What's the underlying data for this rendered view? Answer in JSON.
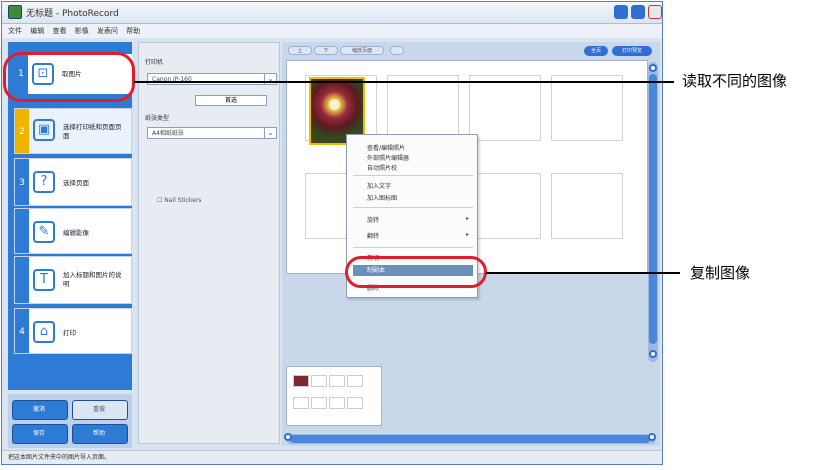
{
  "window": {
    "title": "无标题 - PhotoRecord",
    "menu": [
      "文件",
      "编辑",
      "查看",
      "影像",
      "发表问",
      "帮助"
    ],
    "status": "把这本图片文件夹中的图片导入页面。"
  },
  "steps": [
    {
      "num": "1",
      "label": "取图片",
      "icon_name": "image-import-icon"
    },
    {
      "num": "2",
      "label": "选择打印纸和页面页面",
      "icon_name": "printer-icon"
    },
    {
      "num": "3",
      "label": "选择页面",
      "icon_name": "layout-icon"
    },
    {
      "num": "",
      "label": "编辑影像",
      "icon_name": "edit-image-icon"
    },
    {
      "num": "",
      "label": "加入标题和图片的说明",
      "icon_name": "caption-icon"
    },
    {
      "num": "4",
      "label": "打印",
      "icon_name": "print-icon"
    }
  ],
  "bottom_buttons": [
    "撤消",
    "重做",
    "保存",
    "帮助"
  ],
  "middle": {
    "printer_label": "打印机",
    "printer_value": "Canon iP-160",
    "prefs_button": "首选",
    "paper_label": "纸张类型",
    "paper_value": "A4相纸纸张",
    "checkbox_label": "Nail Stickers"
  },
  "toolbar": {
    "left_labels": [
      "上",
      "下",
      "缩放页面"
    ],
    "right_labels": [
      "全页",
      "打印预览"
    ]
  },
  "context_menu": {
    "items": [
      {
        "label": "查看/编辑照片",
        "submenu": false
      },
      {
        "label": "外部照片编辑器",
        "submenu": false
      },
      {
        "label": "自动照片校",
        "submenu": false
      },
      {
        "label": "加入文字",
        "submenu": false
      },
      {
        "label": "加入图标图",
        "submenu": false
      },
      {
        "label": "旋转",
        "submenu": true
      },
      {
        "label": "翻转",
        "submenu": true
      },
      {
        "label": "",
        "submenu": false
      },
      {
        "label": "剪切",
        "submenu": false
      },
      {
        "label": "删除",
        "submenu": false
      }
    ],
    "highlighted": "制副本"
  },
  "annotations": {
    "read_images": "读取不同的图像",
    "copy_image": "复制图像"
  },
  "colors": {
    "accent_blue": "#2e7bd6",
    "highlight_red": "#e21d2b"
  }
}
